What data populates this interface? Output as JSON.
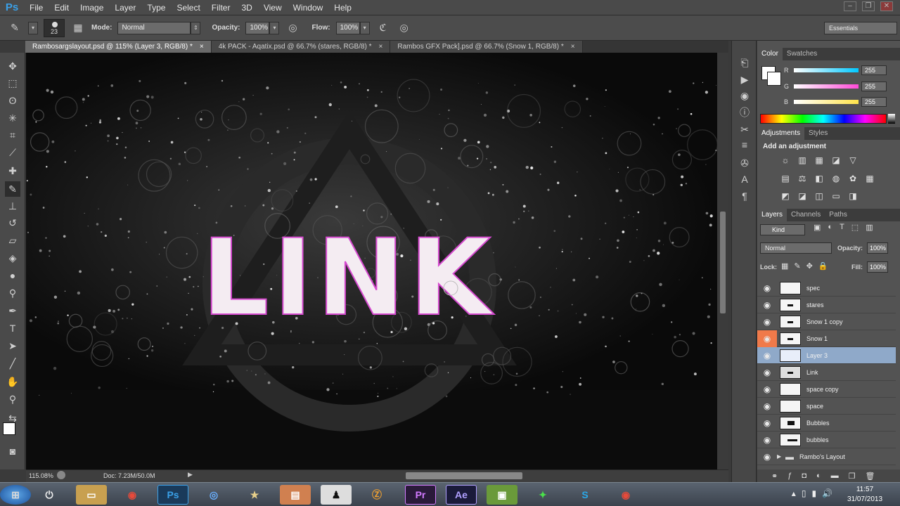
{
  "app": {
    "logo": "Ps"
  },
  "menu": [
    "File",
    "Edit",
    "Image",
    "Layer",
    "Type",
    "Select",
    "Filter",
    "3D",
    "View",
    "Window",
    "Help"
  ],
  "options": {
    "brush_size": "23",
    "mode_label": "Mode:",
    "mode_value": "Normal",
    "opacity_label": "Opacity:",
    "opacity_value": "100%",
    "flow_label": "Flow:",
    "flow_value": "100%",
    "workspace": "Essentials"
  },
  "tabs": [
    {
      "label": "Rambosargslayout.psd @ 115% (Layer 3, RGB/8) *",
      "close": "×"
    },
    {
      "label": "4k PACK - Aqatix.psd @ 66.7% (stares, RGB/8) *",
      "close": "×"
    },
    {
      "label": "Rambos GFX Pack].psd @ 66.7% (Snow 1, RGB/8) *",
      "close": "×"
    }
  ],
  "canvas": {
    "text": "LINK"
  },
  "status": {
    "zoom": "115.08%",
    "doc": "Doc: 7.23M/50.0M"
  },
  "color_panel": {
    "tabs": [
      "Color",
      "Swatches"
    ],
    "sliders": [
      {
        "label": "R",
        "value": "255",
        "gradient": "#00c8ff"
      },
      {
        "label": "G",
        "value": "255",
        "gradient": "#ff4ad8"
      },
      {
        "label": "B",
        "value": "255",
        "gradient": "#ffe34a"
      }
    ]
  },
  "adjustments_panel": {
    "tabs": [
      "Adjustments",
      "Styles"
    ],
    "heading": "Add an adjustment"
  },
  "layers_panel": {
    "tabs": [
      "Layers",
      "Channels",
      "Paths"
    ],
    "filter": "Kind",
    "blend": "Normal",
    "opacity_label": "Opacity:",
    "opacity_value": "100%",
    "lock_label": "Lock:",
    "fill_label": "Fill:",
    "fill_value": "100%",
    "layers": [
      {
        "name": "spec"
      },
      {
        "name": "stares"
      },
      {
        "name": "Snow 1 copy"
      },
      {
        "name": "Snow 1"
      },
      {
        "name": "Layer 3"
      },
      {
        "name": "Link"
      },
      {
        "name": "space copy"
      },
      {
        "name": "space"
      },
      {
        "name": "Bubbles"
      },
      {
        "name": "bubbles"
      },
      {
        "name": "Rambo's Layout"
      }
    ]
  },
  "taskbar": {
    "apps": [
      "Ps",
      "Pr",
      "Ae"
    ],
    "time": "11:57",
    "date": "31/07/2013"
  }
}
